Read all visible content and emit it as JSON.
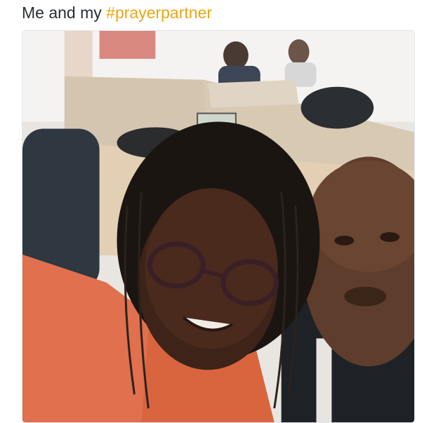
{
  "tweet": {
    "text_prefix": "Me and my ",
    "hashtag": "#prayerpartner"
  },
  "media": {
    "type": "photo",
    "subject": "selfie of two people in an office"
  },
  "colors": {
    "text": "#292f33",
    "hashtag": "#e8a715",
    "card_border": "#e1e8ed"
  }
}
